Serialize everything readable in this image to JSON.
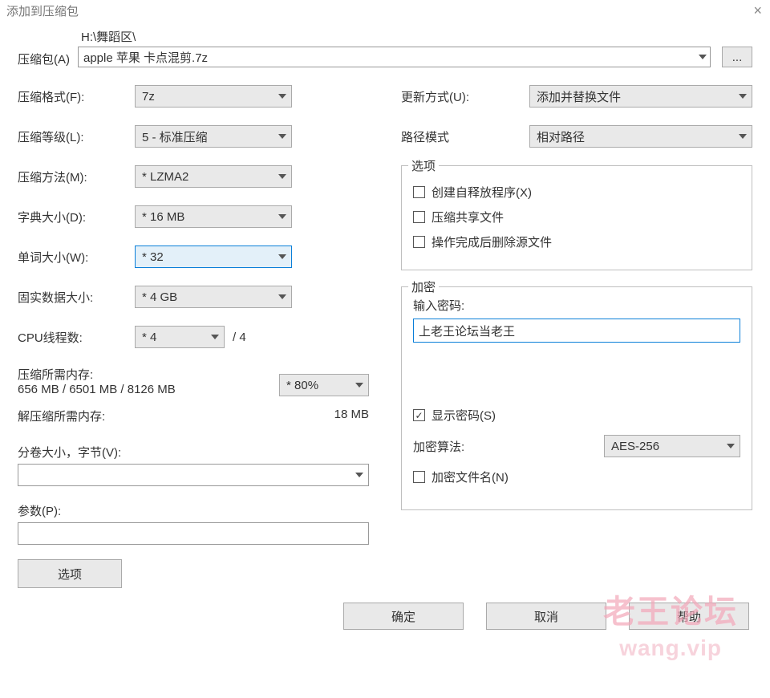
{
  "window": {
    "title": "添加到压缩包",
    "close": "×"
  },
  "archive": {
    "label": "压缩包(A)",
    "path": "H:\\舞蹈区\\",
    "filename": "apple 苹果 卡点混剪.7z",
    "browse": "..."
  },
  "left": {
    "format_label": "压缩格式(F):",
    "format_value": "7z",
    "level_label": "压缩等级(L):",
    "level_value": "5 - 标准压缩",
    "method_label": "压缩方法(M):",
    "method_value": "* LZMA2",
    "dict_label": "字典大小(D):",
    "dict_value": "* 16 MB",
    "word_label": "单词大小(W):",
    "word_value": "* 32",
    "solid_label": "固实数据大小:",
    "solid_value": "* 4 GB",
    "cpu_label": "CPU线程数:",
    "cpu_value": "* 4",
    "cpu_suffix": "/ 4",
    "mem_label": "压缩所需内存:",
    "mem_value": "656 MB / 6501 MB / 8126 MB",
    "mem_pct": "* 80%",
    "decomp_label": "解压缩所需内存:",
    "decomp_value": "18 MB",
    "split_label": "分卷大小，字节(V):",
    "split_value": "",
    "params_label": "参数(P):",
    "params_value": "",
    "options_btn": "选项"
  },
  "right": {
    "update_label": "更新方式(U):",
    "update_value": "添加并替换文件",
    "pathmode_label": "路径模式",
    "pathmode_value": "相对路径",
    "options_legend": "选项",
    "opt_sfx": "创建自释放程序(X)",
    "opt_shared": "压缩共享文件",
    "opt_delete": "操作完成后删除源文件",
    "enc_legend": "加密",
    "pw_label": "输入密码:",
    "pw_value": "上老王论坛当老王",
    "show_pw": "显示密码(S)",
    "enc_alg_label": "加密算法:",
    "enc_alg_value": "AES-256",
    "enc_names": "加密文件名(N)"
  },
  "buttons": {
    "ok": "确定",
    "cancel": "取消",
    "help": "帮助"
  },
  "watermark": {
    "line1": "老王论坛",
    "line2": "wang.vip"
  }
}
